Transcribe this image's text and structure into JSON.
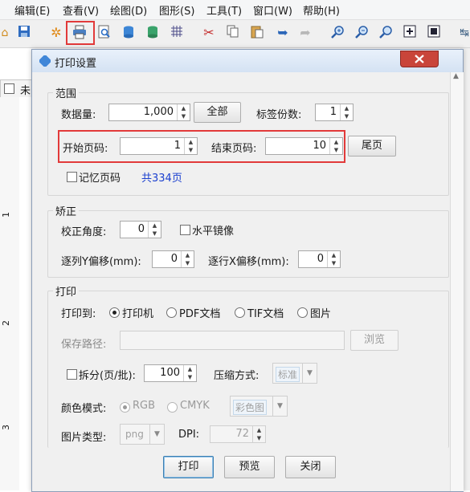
{
  "menu": {
    "items": [
      {
        "label": "编辑(E)"
      },
      {
        "label": "查看(V)"
      },
      {
        "label": "绘图(D)"
      },
      {
        "label": "图形(S)"
      },
      {
        "label": "工具(T)"
      },
      {
        "label": "窗口(W)"
      },
      {
        "label": "帮助(H)"
      }
    ]
  },
  "background": {
    "doc_tab": "未",
    "ruler_numbers": [
      "1",
      "2",
      "3"
    ]
  },
  "dialog": {
    "title": "打印设置",
    "range": {
      "title": "范围",
      "data_count_label": "数据量:",
      "data_count_value": "1,000",
      "all_button": "全部",
      "copies_label": "标签份数:",
      "copies_value": "1",
      "start_page_label": "开始页码:",
      "start_page_value": "1",
      "end_page_label": "结束页码:",
      "end_page_value": "10",
      "last_page_button": "尾页",
      "remember_label": "记忆页码",
      "total_pages": "共334页"
    },
    "correction": {
      "title": "矫正",
      "angle_label": "校正角度:",
      "angle_value": "0",
      "mirror_label": "水平镜像",
      "col_offset_label": "逐列Y偏移(mm):",
      "col_offset_value": "0",
      "row_offset_label": "逐行X偏移(mm):",
      "row_offset_value": "0"
    },
    "print": {
      "title": "打印",
      "print_to_label": "打印到:",
      "options": [
        "打印机",
        "PDF文档",
        "TIF文档",
        "图片"
      ],
      "selected_option": "打印机",
      "save_path_label": "保存路径:",
      "save_path_value": "",
      "browse_button": "浏览",
      "split_label": "拆分(页/批):",
      "split_value": "100",
      "compress_label": "压缩方式:",
      "compress_value": "标准",
      "color_mode_label": "颜色模式:",
      "color_modes": [
        "RGB",
        "CMYK"
      ],
      "selected_color_mode": "RGB",
      "color_value": "彩色图",
      "image_type_label": "图片类型:",
      "image_type_value": "png",
      "dpi_label": "DPI:",
      "dpi_value": "72"
    },
    "buttons": {
      "print": "打印",
      "preview": "预览",
      "close": "关闭"
    }
  },
  "colors": {
    "highlight": "#e23a3a",
    "link_blue": "#1a3fcf",
    "dialog_bg": "#f0f0f0",
    "close_red": "#c9453a"
  },
  "toolbar_icons": [
    "home-icon",
    "save-icon",
    "settings-icon",
    "print-icon",
    "print-preview-icon",
    "database-icon",
    "data-source-icon",
    "grid-icon",
    "cut-icon",
    "copy-icon",
    "paste-icon",
    "undo-icon",
    "redo-icon",
    "zoom-in-icon",
    "zoom-out-icon",
    "zoom-icon",
    "fit-page-icon",
    "fit-window-icon",
    "more-icon"
  ]
}
